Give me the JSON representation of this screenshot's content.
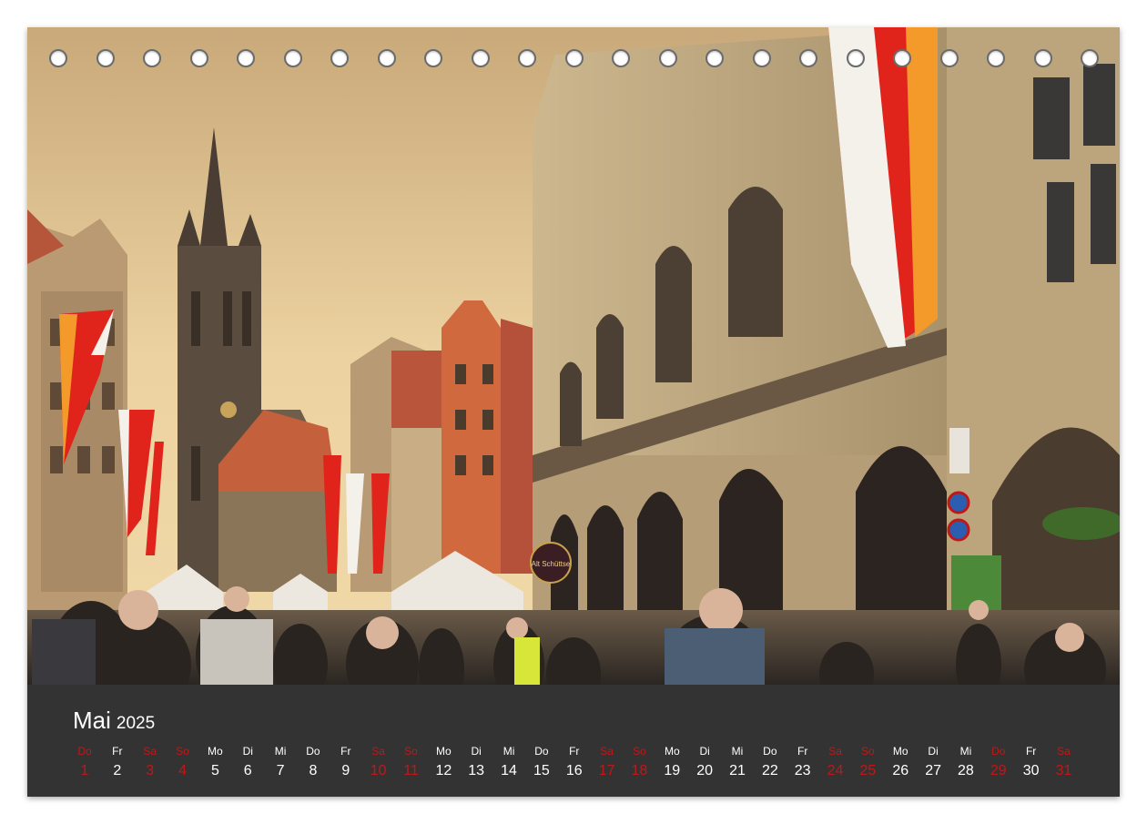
{
  "calendar": {
    "month": "Mai",
    "year": "2025",
    "weekend_color": "#c01818",
    "text_color": "#ffffff",
    "days": [
      {
        "wd": "Do",
        "n": "1",
        "red": true
      },
      {
        "wd": "Fr",
        "n": "2",
        "red": false
      },
      {
        "wd": "Sa",
        "n": "3",
        "red": true
      },
      {
        "wd": "So",
        "n": "4",
        "red": true
      },
      {
        "wd": "Mo",
        "n": "5",
        "red": false
      },
      {
        "wd": "Di",
        "n": "6",
        "red": false
      },
      {
        "wd": "Mi",
        "n": "7",
        "red": false
      },
      {
        "wd": "Do",
        "n": "8",
        "red": false
      },
      {
        "wd": "Fr",
        "n": "9",
        "red": false
      },
      {
        "wd": "Sa",
        "n": "10",
        "red": true
      },
      {
        "wd": "So",
        "n": "11",
        "red": true
      },
      {
        "wd": "Mo",
        "n": "12",
        "red": false
      },
      {
        "wd": "Di",
        "n": "13",
        "red": false
      },
      {
        "wd": "Mi",
        "n": "14",
        "red": false
      },
      {
        "wd": "Do",
        "n": "15",
        "red": false
      },
      {
        "wd": "Fr",
        "n": "16",
        "red": false
      },
      {
        "wd": "Sa",
        "n": "17",
        "red": true
      },
      {
        "wd": "So",
        "n": "18",
        "red": true
      },
      {
        "wd": "Mo",
        "n": "19",
        "red": false
      },
      {
        "wd": "Di",
        "n": "20",
        "red": false
      },
      {
        "wd": "Mi",
        "n": "21",
        "red": false
      },
      {
        "wd": "Do",
        "n": "22",
        "red": false
      },
      {
        "wd": "Fr",
        "n": "23",
        "red": false
      },
      {
        "wd": "Sa",
        "n": "24",
        "red": true
      },
      {
        "wd": "So",
        "n": "25",
        "red": true
      },
      {
        "wd": "Mo",
        "n": "26",
        "red": false
      },
      {
        "wd": "Di",
        "n": "27",
        "red": false
      },
      {
        "wd": "Mi",
        "n": "28",
        "red": false
      },
      {
        "wd": "Do",
        "n": "29",
        "red": true
      },
      {
        "wd": "Fr",
        "n": "30",
        "red": false
      },
      {
        "wd": "Sa",
        "n": "31",
        "red": true
      }
    ]
  },
  "photo": {
    "subject": "old-town-street-with-gothic-church-and-arcades",
    "sign_text": "Alt Schüttse",
    "colors": {
      "sky": "#e9c98e",
      "stone": "#c9b189",
      "roof": "#c4603c",
      "flag_red": "#e0241c",
      "flag_white": "#f4f0ea"
    }
  },
  "binding": {
    "hole_count": 23
  }
}
